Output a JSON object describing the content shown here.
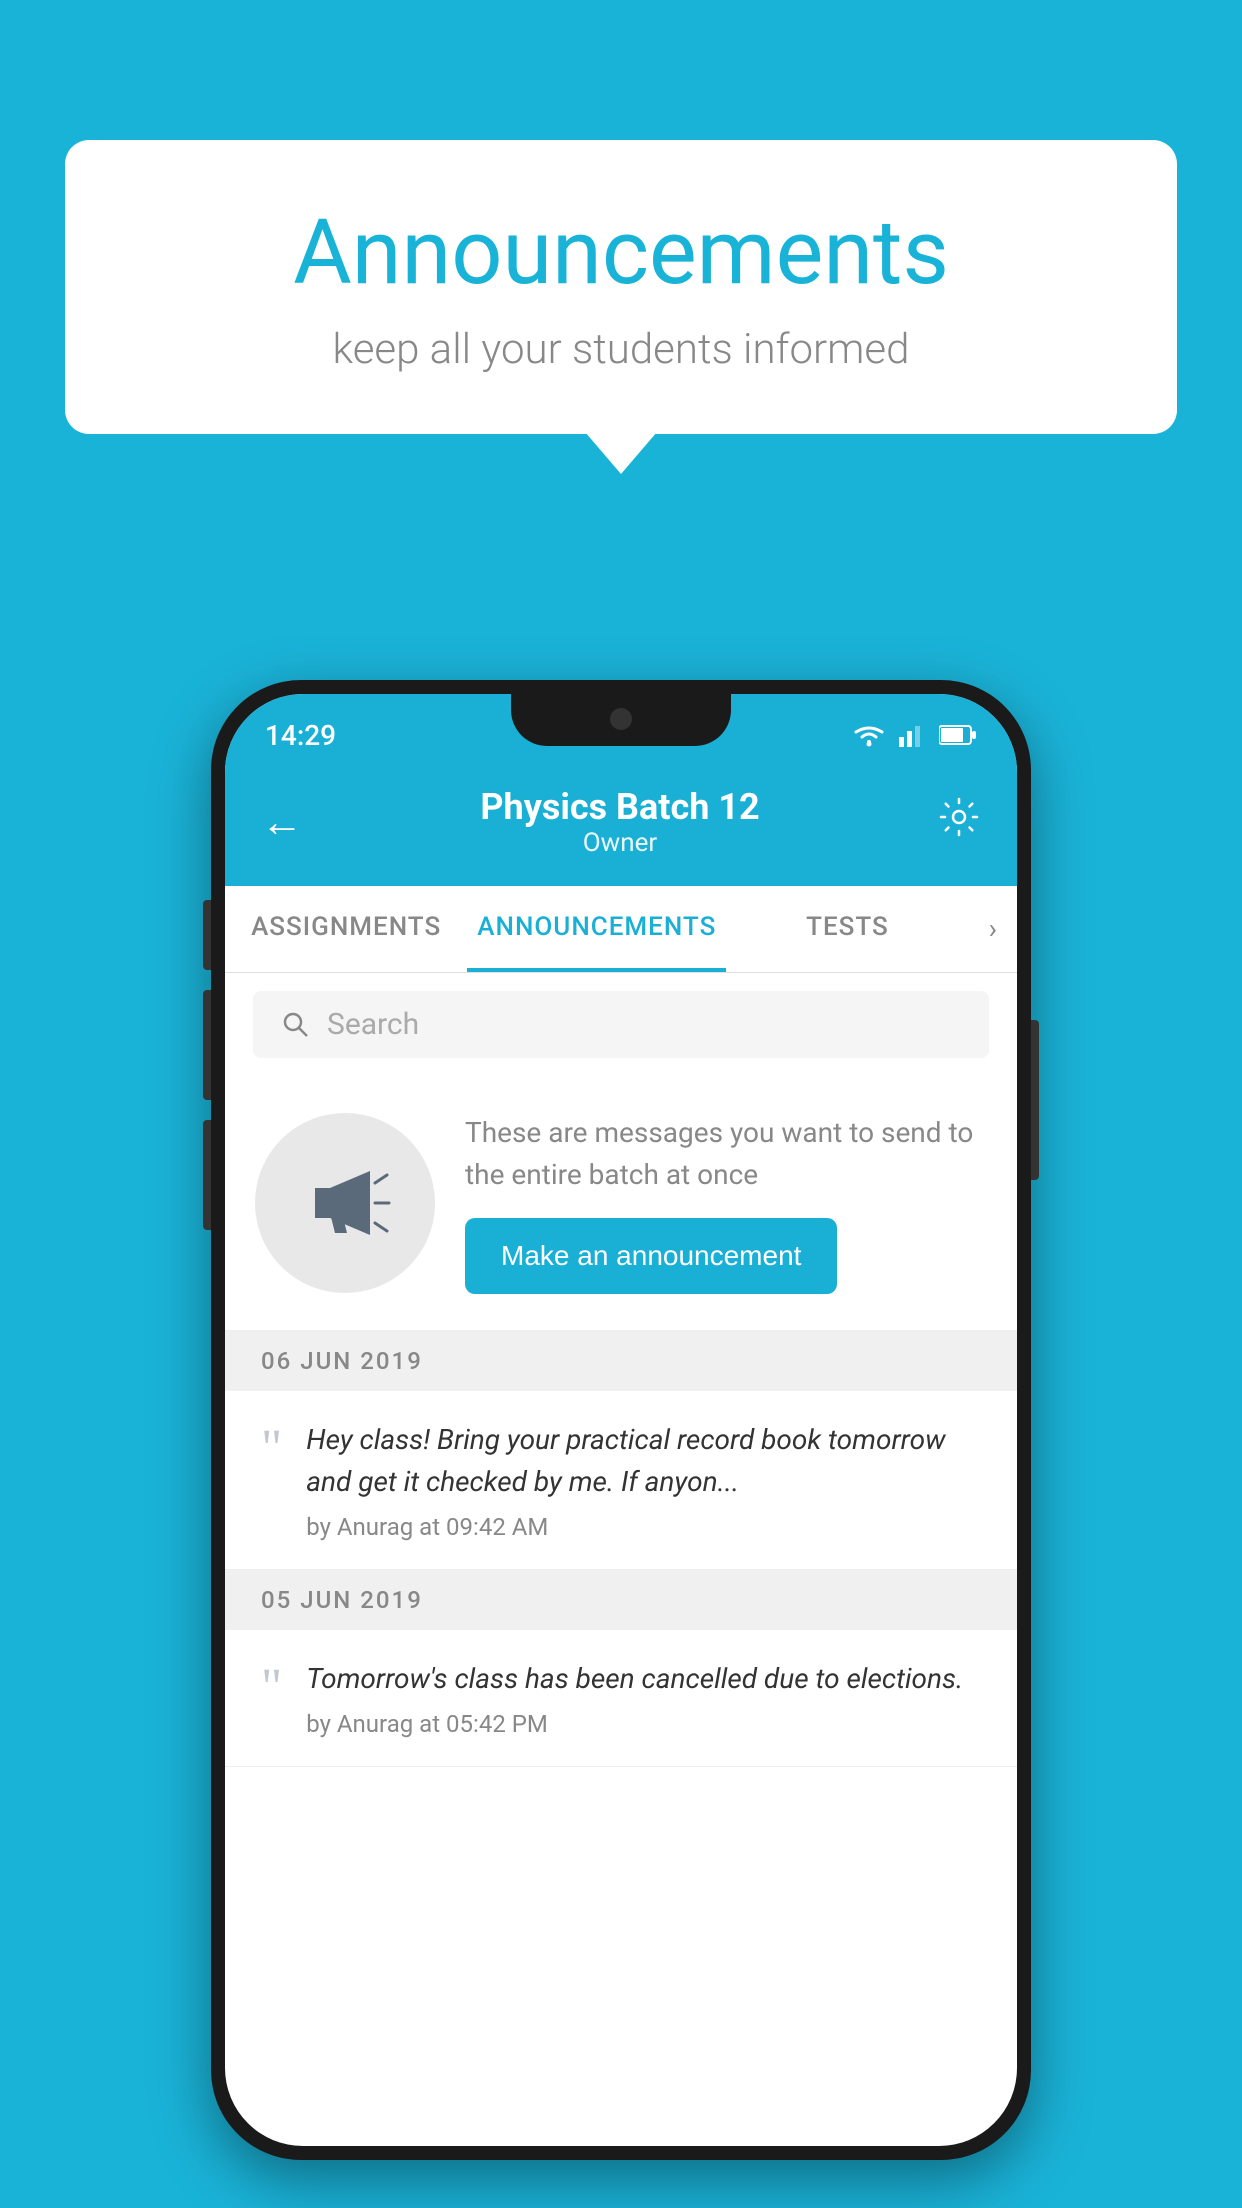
{
  "background_color": "#1ab3d8",
  "speech_bubble": {
    "title": "Announcements",
    "subtitle": "keep all your students informed"
  },
  "phone": {
    "status_bar": {
      "time": "14:29"
    },
    "header": {
      "title": "Physics Batch 12",
      "subtitle": "Owner",
      "back_label": "←",
      "gear_label": "⚙"
    },
    "tabs": [
      {
        "label": "ASSIGNMENTS",
        "active": false
      },
      {
        "label": "ANNOUNCEMENTS",
        "active": true
      },
      {
        "label": "TESTS",
        "active": false
      }
    ],
    "search": {
      "placeholder": "Search"
    },
    "promo": {
      "description": "These are messages you want to send to the entire batch at once",
      "button_label": "Make an announcement"
    },
    "announcements": [
      {
        "date": "06  JUN  2019",
        "text": "Hey class! Bring your practical record book tomorrow and get it checked by me. If anyon...",
        "meta": "by Anurag at 09:42 AM"
      },
      {
        "date": "05  JUN  2019",
        "text": "Tomorrow's class has been cancelled due to elections.",
        "meta": "by Anurag at 05:42 PM"
      }
    ]
  }
}
